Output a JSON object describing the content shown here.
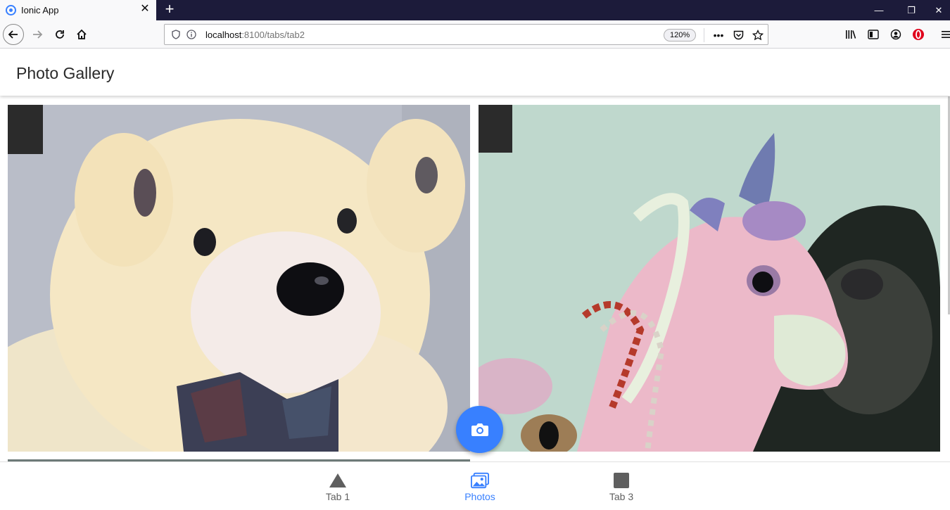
{
  "browser": {
    "tab_title": "Ionic App",
    "url_host": "localhost",
    "url_path": ":8100/tabs/tab2",
    "zoom": "120%"
  },
  "app": {
    "title": "Photo Gallery",
    "photos": [
      {
        "subject": "teddy-bear"
      },
      {
        "subject": "unicorn-plush"
      }
    ],
    "tabs": [
      {
        "label": "Tab 1",
        "icon": "triangle-icon",
        "active": false
      },
      {
        "label": "Photos",
        "icon": "images-icon",
        "active": true
      },
      {
        "label": "Tab 3",
        "icon": "square-icon",
        "active": false
      }
    ],
    "colors": {
      "primary": "#3880ff",
      "tab_inactive": "#5f5f5f"
    }
  }
}
